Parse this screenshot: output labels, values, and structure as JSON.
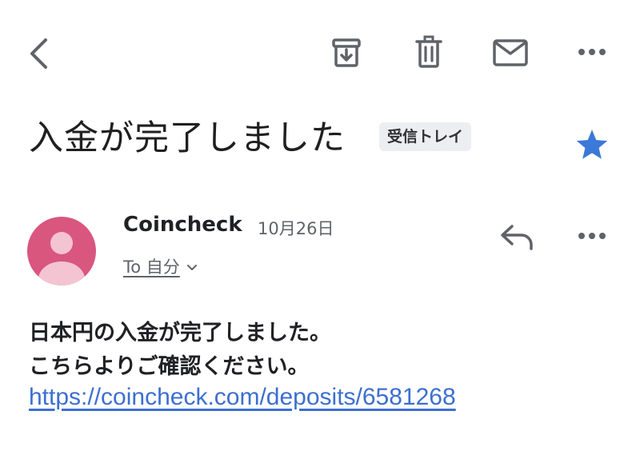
{
  "toolbar": {
    "back_icon": "back-arrow-icon",
    "archive_icon": "archive-icon",
    "delete_icon": "trash-icon",
    "mark_unread_icon": "mail-icon",
    "more_icon": "more-horizontal-icon"
  },
  "message": {
    "subject": "入金が完了しました",
    "label": "受信トレイ",
    "starred": true,
    "star_color": "#3b78d8"
  },
  "sender": {
    "name": "Coincheck",
    "date": "10月26日",
    "recipient": "To 自分",
    "avatar_color": "#d9567f"
  },
  "body": {
    "line1": "日本円の入金が完了しました。",
    "line2": "こちらよりご確認ください。",
    "link": "https://coincheck.com/deposits/6581268"
  },
  "colors": {
    "icon_gray": "#5f6368",
    "link_blue": "#3c6fd0"
  }
}
